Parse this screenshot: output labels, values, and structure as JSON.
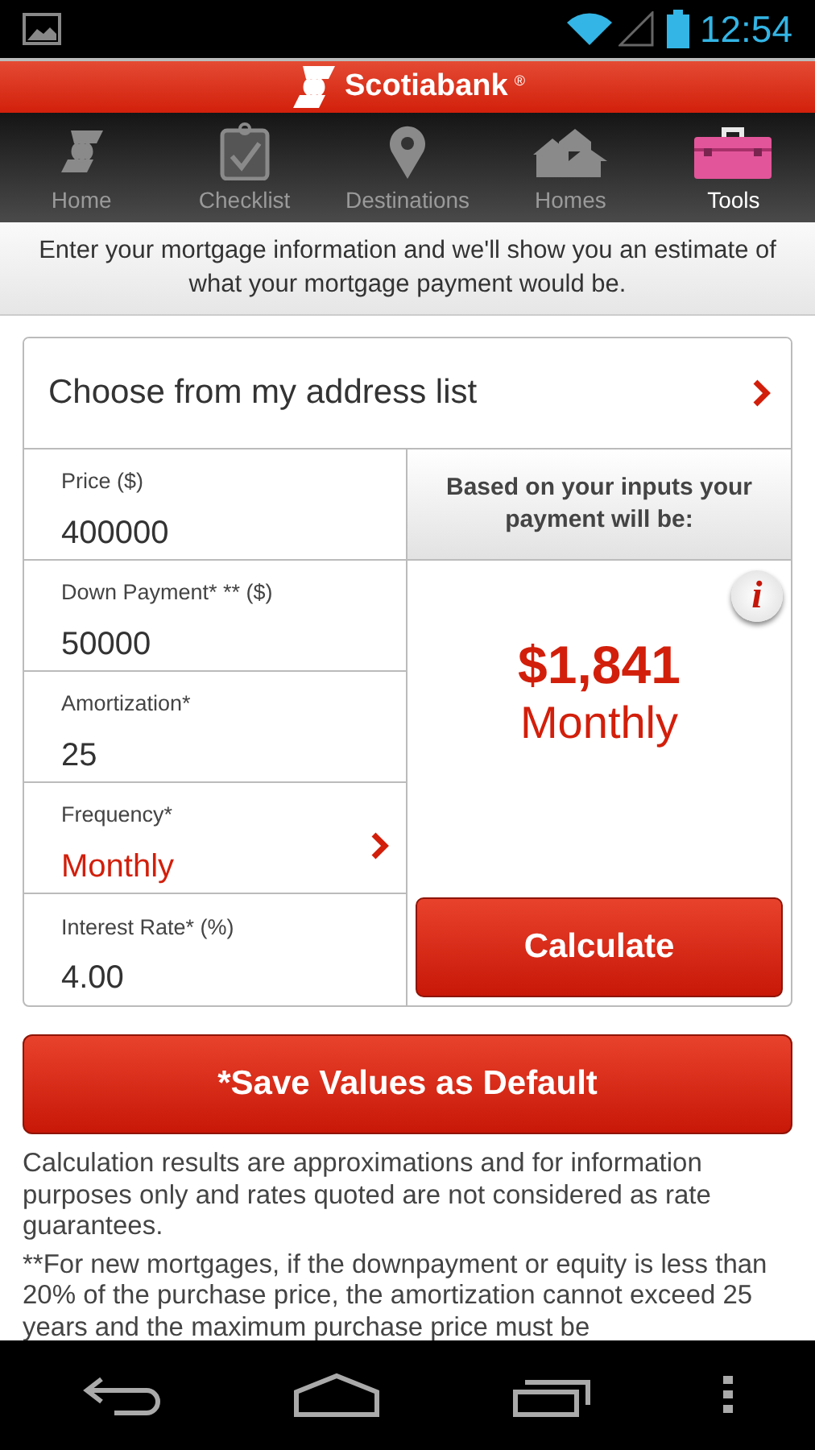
{
  "status_bar": {
    "time": "12:54"
  },
  "header": {
    "brand": "Scotiabank",
    "mark": "®"
  },
  "tabs": [
    {
      "label": "Home",
      "selected": false
    },
    {
      "label": "Checklist",
      "selected": false
    },
    {
      "label": "Destinations",
      "selected": false
    },
    {
      "label": "Homes",
      "selected": false
    },
    {
      "label": "Tools",
      "selected": true
    }
  ],
  "intro": "Enter your mortgage information and we'll show you an estimate of what your mortgage payment would be.",
  "address_picker": "Choose from my address list",
  "fields": [
    {
      "label": "Price ($)",
      "value": "400000",
      "kind": "text"
    },
    {
      "label": "Down Payment* ** ($)",
      "value": "50000",
      "kind": "text"
    },
    {
      "label": "Amortization*",
      "value": "25",
      "kind": "text"
    },
    {
      "label": "Frequency*",
      "value": "Monthly",
      "kind": "select"
    },
    {
      "label": "Interest Rate* (%)",
      "value": "4.00",
      "kind": "text"
    }
  ],
  "result": {
    "heading": "Based on your inputs your payment will be:",
    "info": "i",
    "amount": "$1,841",
    "period": "Monthly",
    "button": "Calculate"
  },
  "save_button": "*Save Values as Default",
  "notes": [
    "Calculation results are approximations and for information purposes only and rates quoted are not considered as rate guarantees.",
    "**For new mortgages, if the downpayment or equity is less than 20% of the purchase price, the amortization cannot exceed 25 years and the maximum purchase price must be"
  ]
}
